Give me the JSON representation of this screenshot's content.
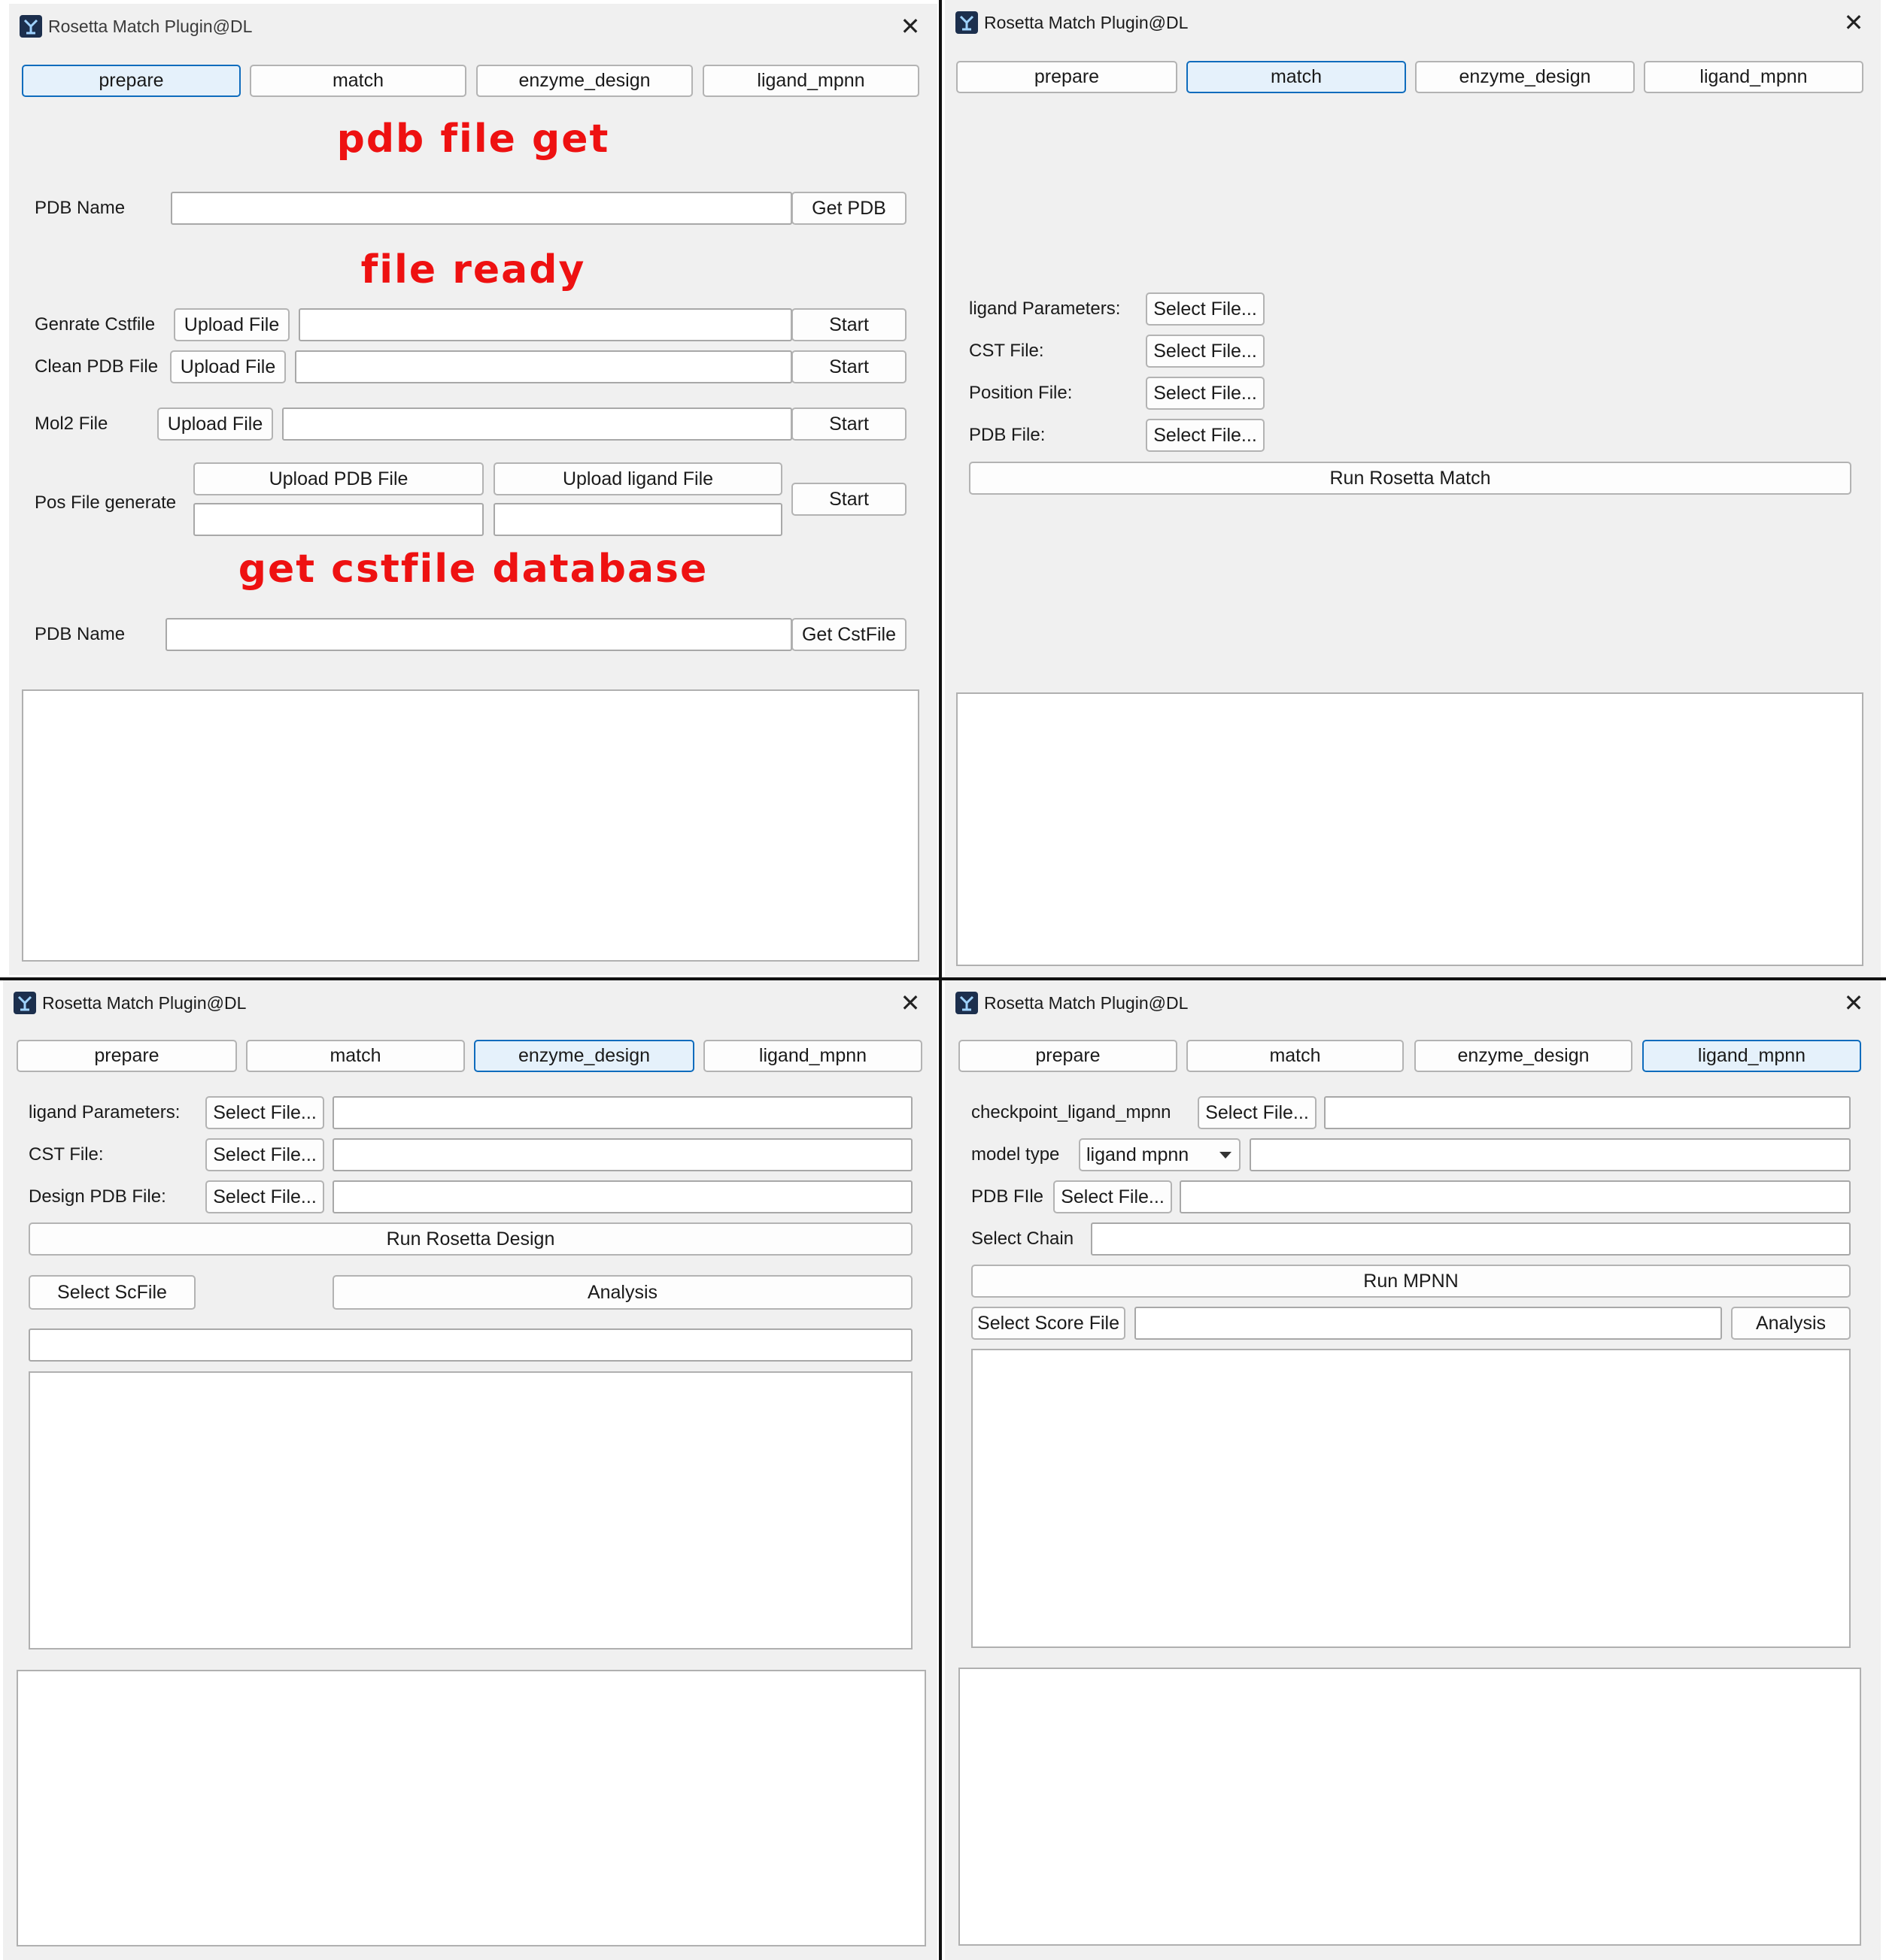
{
  "window_title": "Rosetta Match Plugin@DL",
  "tabs": [
    "prepare",
    "match",
    "enzyme_design",
    "ligand_mpnn"
  ],
  "prepare": {
    "heading_pdb": "pdb file get",
    "pdb_name_label": "PDB Name",
    "get_pdb": "Get PDB",
    "heading_ready": "file ready",
    "genrate_cst_label": "Genrate Cstfile",
    "clean_pdb_label": "Clean PDB File",
    "mol2_label": "Mol2 File",
    "upload_file": "Upload File",
    "start": "Start",
    "pos_file_label": "Pos File generate",
    "upload_pdb_file": "Upload PDB File",
    "upload_ligand_file": "Upload ligand File",
    "heading_cst_db": "get cstfile database",
    "pdb_name_label_2": "PDB Name",
    "get_cstfile": "Get CstFile"
  },
  "match": {
    "ligand_params_label": "ligand Parameters:",
    "cst_file_label": "CST File:",
    "position_file_label": "Position File:",
    "pdb_file_label": "PDB File:",
    "select_file": "Select File...",
    "run": "Run Rosetta Match"
  },
  "enzyme_design": {
    "ligand_params_label": "ligand Parameters:",
    "cst_file_label": "CST File:",
    "design_pdb_label": "Design PDB File:",
    "select_file": "Select File...",
    "run": "Run Rosetta Design",
    "select_scfile": "Select ScFile",
    "analysis": "Analysis"
  },
  "ligand_mpnn": {
    "checkpoint_label": "checkpoint_ligand_mpnn",
    "select_file": "Select File...",
    "model_type_label": "model type",
    "model_type_value": "ligand mpnn",
    "pdb_file_label": "PDB FIle",
    "select_chain_label": "Select Chain",
    "run": "Run MPNN",
    "select_score_file": "Select Score File",
    "analysis": "Analysis"
  },
  "colors": {
    "heading_red": "#ee1111",
    "active_tab_border": "#0f6cbd",
    "active_tab_bg": "#e5f1fb",
    "window_bg": "#f0f0f0"
  },
  "icons": [
    "app-icon",
    "close-icon",
    "chevron-down-icon"
  ]
}
